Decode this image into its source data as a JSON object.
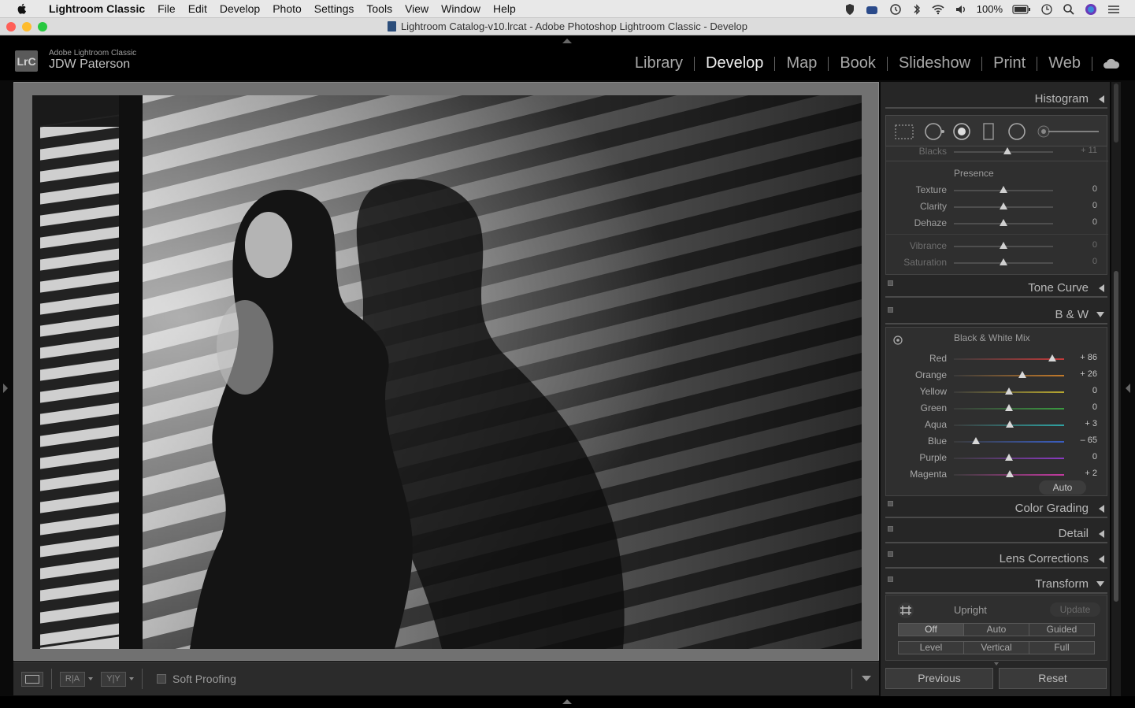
{
  "menubar": {
    "app": "Lightroom Classic",
    "items": [
      "File",
      "Edit",
      "Develop",
      "Photo",
      "Settings",
      "Tools",
      "View",
      "Window",
      "Help"
    ],
    "battery": "100%"
  },
  "titlebar": {
    "title": "Lightroom Catalog-v10.lrcat - Adobe Photoshop Lightroom Classic - Develop"
  },
  "identity": {
    "logo": "LrC",
    "product": "Adobe Lightroom Classic",
    "user": "JDW Paterson"
  },
  "modules": [
    "Library",
    "Develop",
    "Map",
    "Book",
    "Slideshow",
    "Print",
    "Web"
  ],
  "active_module": "Develop",
  "toolbar": {
    "soft_proofing": "Soft Proofing",
    "ra_label": "R|A",
    "yy_label": "Y|Y"
  },
  "panels": {
    "histogram": "Histogram",
    "basic_cut": {
      "label": "Blacks",
      "value": "+ 11"
    },
    "presence": {
      "title": "Presence",
      "sliders": [
        {
          "label": "Texture",
          "value": "0",
          "pos": 0.5
        },
        {
          "label": "Clarity",
          "value": "0",
          "pos": 0.5
        },
        {
          "label": "Dehaze",
          "value": "0",
          "pos": 0.5
        },
        {
          "label": "Vibrance",
          "value": "0",
          "pos": 0.5
        },
        {
          "label": "Saturation",
          "value": "0",
          "pos": 0.5
        }
      ]
    },
    "tone_curve": "Tone Curve",
    "bw": {
      "title": "B & W",
      "mix_title": "Black & White Mix",
      "auto": "Auto",
      "channels": [
        {
          "label": "Red",
          "value": "+ 86",
          "pos": 0.89,
          "color": "#c23a3a"
        },
        {
          "label": "Orange",
          "value": "+ 26",
          "pos": 0.62,
          "color": "#c27a2a"
        },
        {
          "label": "Yellow",
          "value": "0",
          "pos": 0.5,
          "color": "#b8a830"
        },
        {
          "label": "Green",
          "value": "0",
          "pos": 0.5,
          "color": "#3a9a40"
        },
        {
          "label": "Aqua",
          "value": "+ 3",
          "pos": 0.51,
          "color": "#2fa3a3"
        },
        {
          "label": "Blue",
          "value": "– 65",
          "pos": 0.2,
          "color": "#3a5ec2"
        },
        {
          "label": "Purple",
          "value": "0",
          "pos": 0.5,
          "color": "#8a3ac2"
        },
        {
          "label": "Magenta",
          "value": "+ 2",
          "pos": 0.51,
          "color": "#c23aa0"
        }
      ]
    },
    "color_grading": "Color Grading",
    "detail": "Detail",
    "lens_corrections": "Lens Corrections",
    "transform": {
      "title": "Transform",
      "upright": "Upright",
      "update": "Update",
      "row1": [
        "Off",
        "Auto",
        "Guided"
      ],
      "row2": [
        "Level",
        "Vertical",
        "Full"
      ]
    }
  },
  "bottom_buttons": {
    "previous": "Previous",
    "reset": "Reset"
  }
}
